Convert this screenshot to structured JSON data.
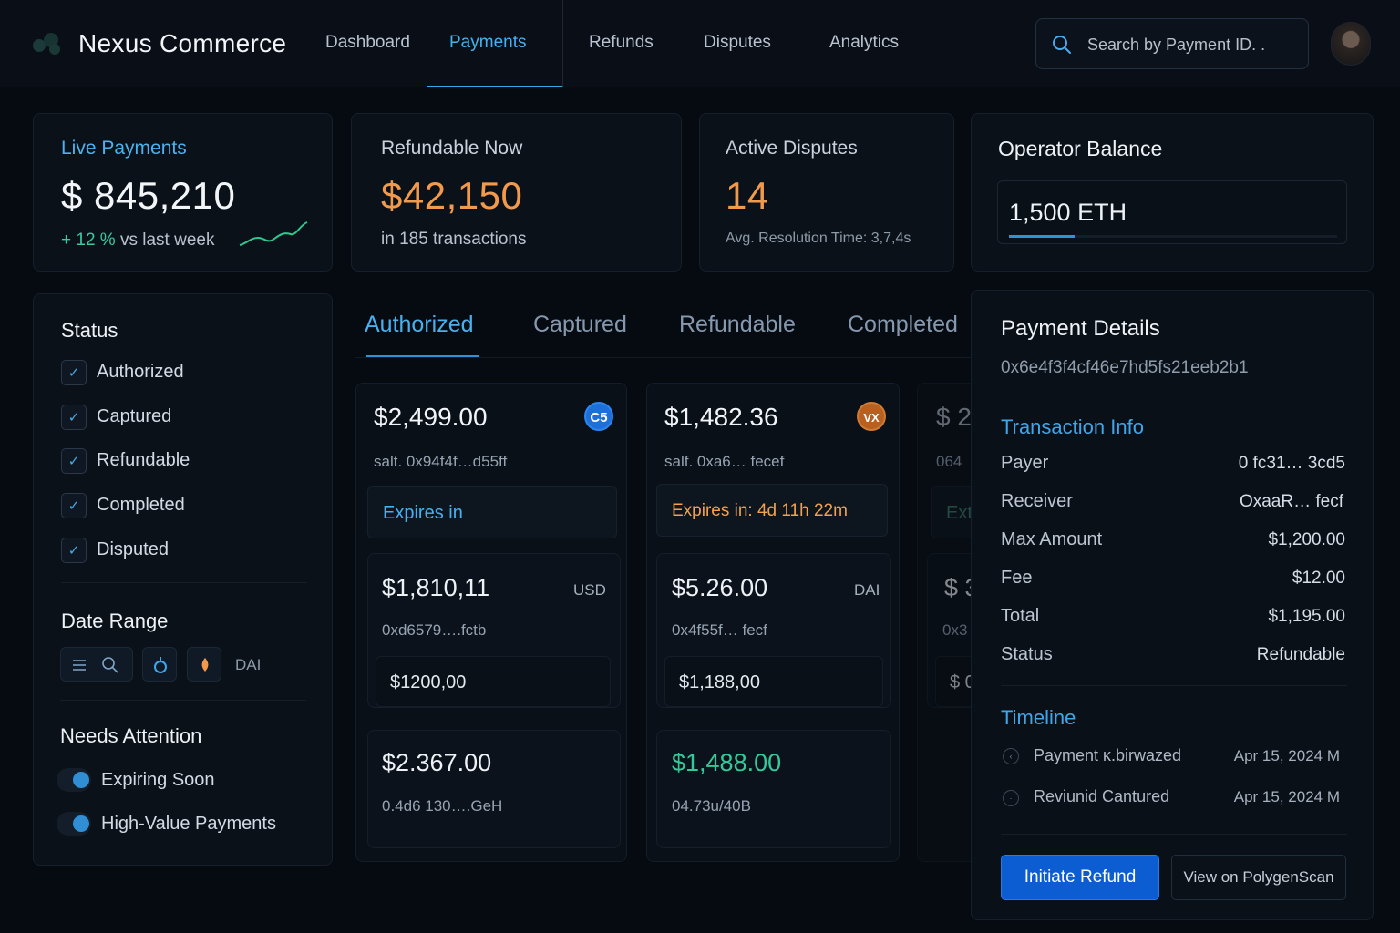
{
  "app": {
    "brand": "Nexus Commerce"
  },
  "nav": {
    "items": [
      {
        "label": "Dashboard"
      },
      {
        "label": "Payments"
      },
      {
        "label": "Refunds"
      },
      {
        "label": "Disputes"
      },
      {
        "label": "Analytics"
      }
    ],
    "active": "Payments"
  },
  "search": {
    "placeholder": "Search by Payment ID. ."
  },
  "stats": {
    "live": {
      "title": "Live Payments",
      "value": "$ 845,210",
      "change": "+ 12 %",
      "change_suffix": "vs last week"
    },
    "refundable": {
      "title": "Refundable Now",
      "value": "$42,150",
      "sub": "in 185 transactions"
    },
    "disputes": {
      "title": "Active Disputes",
      "value": "14",
      "sub": "Avg. Resolution Time: 3,7,4s"
    },
    "balance": {
      "title": "Operator Balance",
      "value": "1,500 ETH",
      "fill": 0.2
    }
  },
  "filters": {
    "status_title": "Status",
    "statuses": [
      {
        "label": "Authorized",
        "checked": true
      },
      {
        "label": "Captured",
        "checked": true
      },
      {
        "label": "Refundable",
        "checked": true
      },
      {
        "label": "Completed",
        "checked": true
      },
      {
        "label": "Disputed",
        "checked": true
      }
    ],
    "date_title": "Date Range",
    "date_chip_text": "DAI",
    "attention_title": "Needs Attention",
    "attention": [
      {
        "label": "Expiring Soon",
        "on": true
      },
      {
        "label": "High-Value Payments",
        "on": true
      }
    ]
  },
  "tabs": [
    "Authorized",
    "Captured",
    "Refundable",
    "Completed"
  ],
  "payments": {
    "col1": {
      "amount": "$2,499.00",
      "hash": "salt. 0x94f4f…d55ff",
      "expires": "Expires in",
      "coin": "C5",
      "inner1": {
        "amount": "$1,810,11",
        "currency": "USD",
        "hash": "0xd6579….fctb",
        "sub": "$1200,00"
      },
      "inner2": {
        "amount": "$2.367.00",
        "hash": "0.4d6 130….GeH"
      }
    },
    "col2": {
      "amount": "$1,482.36",
      "hash": "salf. 0xa6… fecef",
      "expires": "Expires in: 4d 11h 22m",
      "coin": "VX",
      "inner1": {
        "amount": "$5.26.00",
        "currency": "DAI",
        "hash": "0x4f55f… fecf",
        "sub": "$1,188,00"
      },
      "inner2": {
        "amount": "$1,488.00",
        "hash": "04.73u/40B"
      }
    },
    "col3": {
      "amount": "$ 2",
      "hash": "064",
      "expires": "Ext",
      "inner1": {
        "amount": "$ 3",
        "hash": "0x3",
        "sub": "$ 0"
      }
    }
  },
  "details": {
    "title": "Payment Details",
    "id": "0x6e4f3f4cf46e7hd5fs21eeb2b1",
    "tx_title": "Transaction Info",
    "rows": [
      {
        "label": "Payer",
        "value": "0 fc31… 3cd5"
      },
      {
        "label": "Receiver",
        "value": "OxaaR… fecf"
      },
      {
        "label": "Max Amount",
        "value": "$1,200.00"
      },
      {
        "label": "Fee",
        "value": "$12.00"
      },
      {
        "label": "Total",
        "value": "$1,195.00"
      },
      {
        "label": "Status",
        "value": "Refundable"
      }
    ],
    "timeline_title": "Timeline",
    "timeline": [
      {
        "text": "Payment ĸ.birwazed",
        "date": "Apr 15, 2024 M"
      },
      {
        "text": "Reviunid Cantured",
        "date": "Apr 15, 2024 M"
      }
    ],
    "primary_button": "Initiate Refund",
    "secondary_button": "View on PolygenScan"
  },
  "colors": {
    "accent_blue": "#3fa6ea",
    "orange": "#f2994a",
    "green": "#34c99a",
    "primary_button": "#0b5dd1"
  },
  "icons": [
    "logo-icon",
    "search-icon",
    "check-icon",
    "list-icon",
    "usdc-coin-icon",
    "token-coin-icon",
    "clock-icon"
  ]
}
